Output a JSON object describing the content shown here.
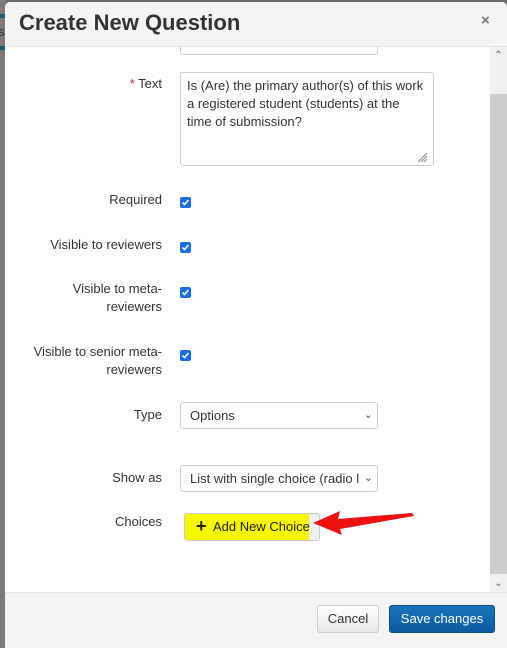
{
  "background": {
    "peek_text": "s"
  },
  "modal": {
    "title": "Create New Question",
    "close_glyph": "×"
  },
  "form": {
    "text_field": {
      "required_marker": "*",
      "label": "Text",
      "value": "Is (Are) the primary author(s) of this work a registered student (students) at the time of submission?"
    },
    "checkboxes": [
      {
        "label": "Required",
        "checked": true
      },
      {
        "label": "Visible to reviewers",
        "checked": true
      },
      {
        "label": "Visible to meta-reviewers",
        "checked": true
      },
      {
        "label": "Visible to senior meta-reviewers",
        "checked": true
      }
    ],
    "type": {
      "label": "Type",
      "selected": "Options"
    },
    "show_as": {
      "label": "Show as",
      "selected": "List with single choice (radio buttons)",
      "visible_text": "List with single choice (radio l"
    },
    "choices": {
      "label": "Choices",
      "add_button": "Add New Choice",
      "add_icon": "+"
    }
  },
  "annotation": {
    "arrow_color": "#ee1111",
    "highlight_color": "#f7f700"
  },
  "footer": {
    "cancel_label": "Cancel",
    "save_label": "Save changes"
  },
  "colors": {
    "primary": "#0d5a9e",
    "checkbox": "#1a6fdc"
  }
}
